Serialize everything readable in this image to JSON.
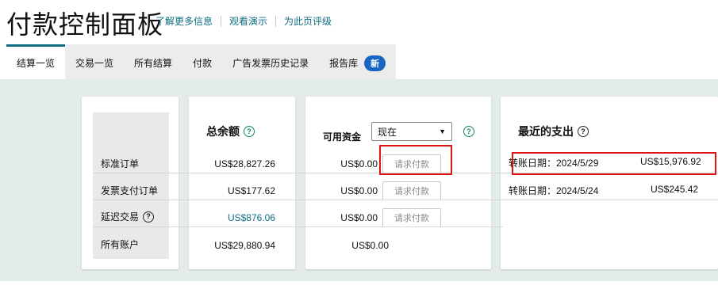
{
  "header": {
    "title": "付款控制面板",
    "links": [
      "了解更多信息",
      "观看演示",
      "为此页评级"
    ]
  },
  "tabs": [
    {
      "label": "结算一览"
    },
    {
      "label": "交易一览"
    },
    {
      "label": "所有结算"
    },
    {
      "label": "付款"
    },
    {
      "label": "广告发票历史记录"
    },
    {
      "label": "报告库"
    }
  ],
  "new_badge": "新",
  "rows": [
    {
      "label": "标准订单"
    },
    {
      "label": "发票支付订单"
    },
    {
      "label": "延迟交易"
    },
    {
      "label": "所有账户"
    }
  ],
  "total": {
    "title": "总余额",
    "values": [
      "US$28,827.26",
      "US$177.62",
      "US$876.06",
      "US$29,880.94"
    ]
  },
  "available": {
    "title": "可用资金",
    "selected": "现在",
    "values": [
      "US$0.00",
      "US$0.00",
      "US$0.00",
      "US$0.00"
    ],
    "request_label": "请求付款"
  },
  "recent": {
    "title": "最近的支出",
    "items": [
      {
        "date": "转账日期：2024/5/29",
        "amount": "US$15,976.92"
      },
      {
        "date": "转账日期：2024/5/24",
        "amount": "US$245.42"
      }
    ]
  },
  "icons": {
    "help": "help-icon",
    "dropdown": "chevron-down-icon"
  },
  "colors": {
    "accent": "#0f6d83",
    "badge": "#1764c4",
    "highlight": "#e01515",
    "background": "#e3ebeb"
  }
}
